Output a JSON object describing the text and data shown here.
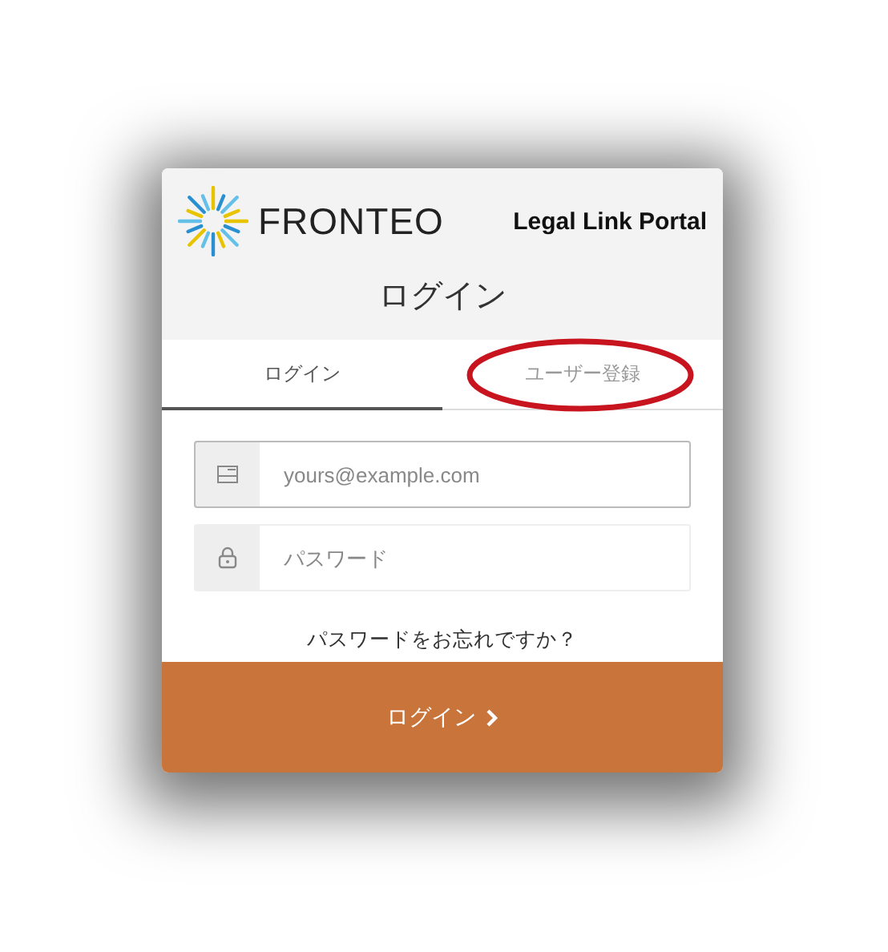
{
  "brand": {
    "name": "FRONTEO",
    "product": "Legal Link Portal"
  },
  "title": "ログイン",
  "tabs": [
    {
      "label": "ログイン",
      "selected": true,
      "highlighted": false
    },
    {
      "label": "ユーザー登録",
      "selected": false,
      "highlighted": true
    }
  ],
  "fields": [
    {
      "kind": "email",
      "placeholder": "yours@example.com",
      "focused": true
    },
    {
      "kind": "password",
      "placeholder": "パスワード",
      "focused": false
    }
  ],
  "forgot_link": "パスワードをお忘れですか？",
  "submit_button": "ログイン"
}
